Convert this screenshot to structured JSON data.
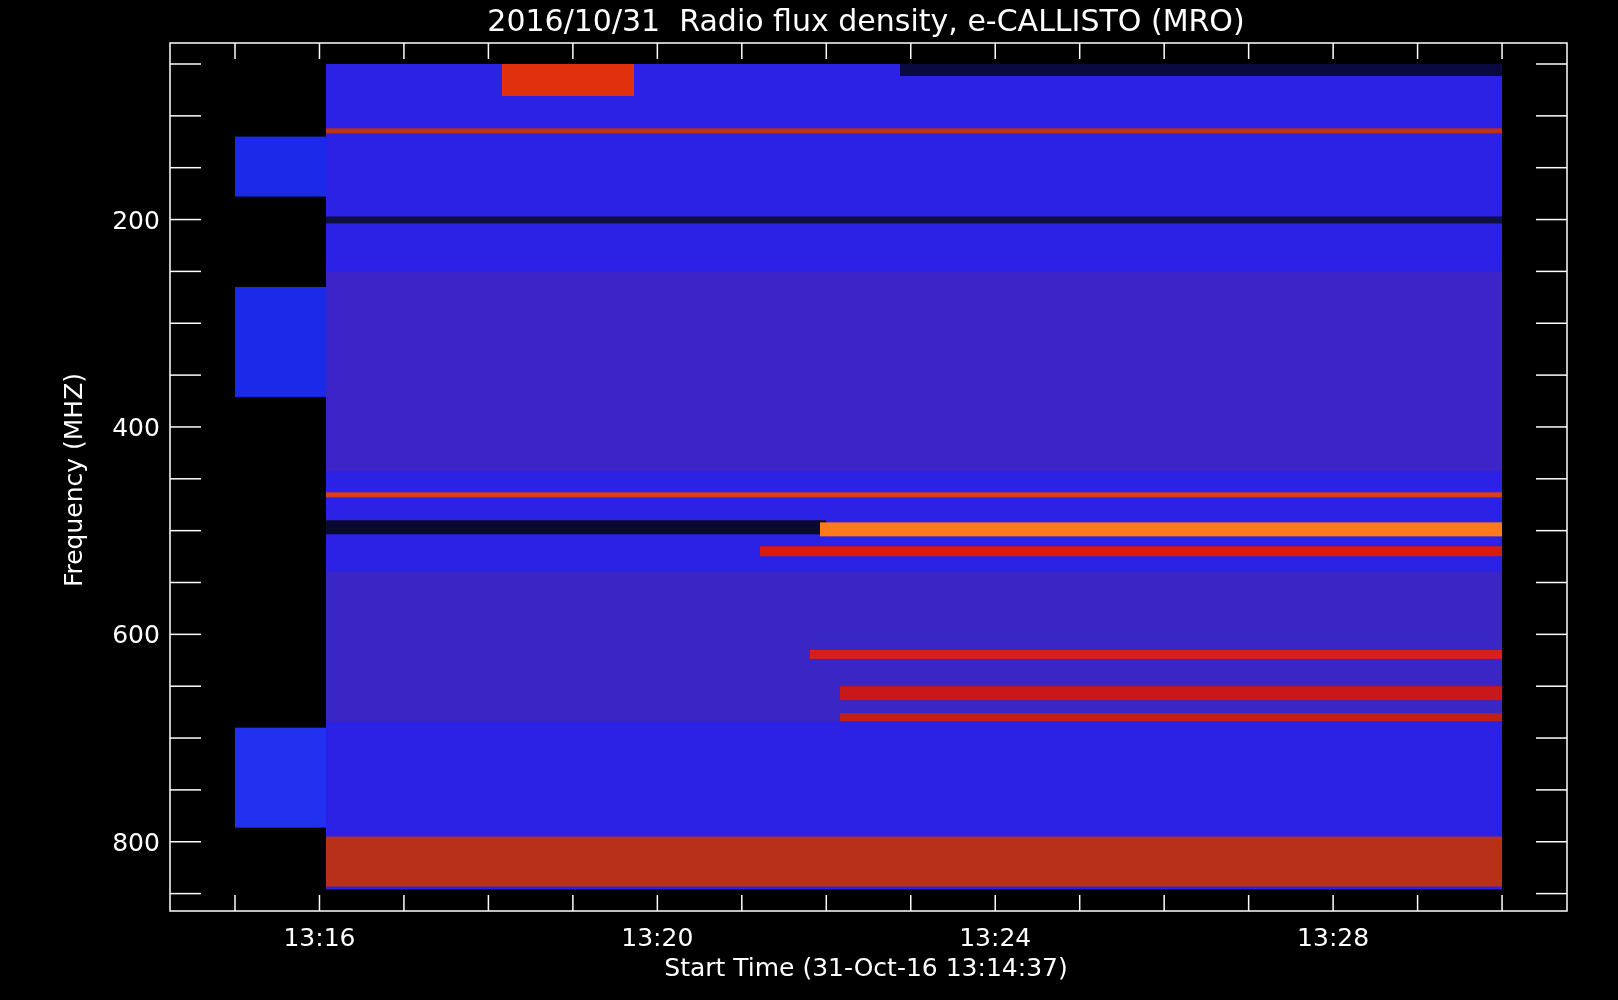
{
  "plot": {
    "title": "2016/10/31  Radio flux density, e-CALLISTO (MRO)",
    "xlabel": "Start Time (31-Oct-16 13:14:37)",
    "ylabel": "Frequency (MHZ)",
    "xticks": [
      "13:16",
      "13:20",
      "13:24",
      "13:28"
    ],
    "yticks": [
      "200",
      "400",
      "600",
      "800"
    ]
  }
}
